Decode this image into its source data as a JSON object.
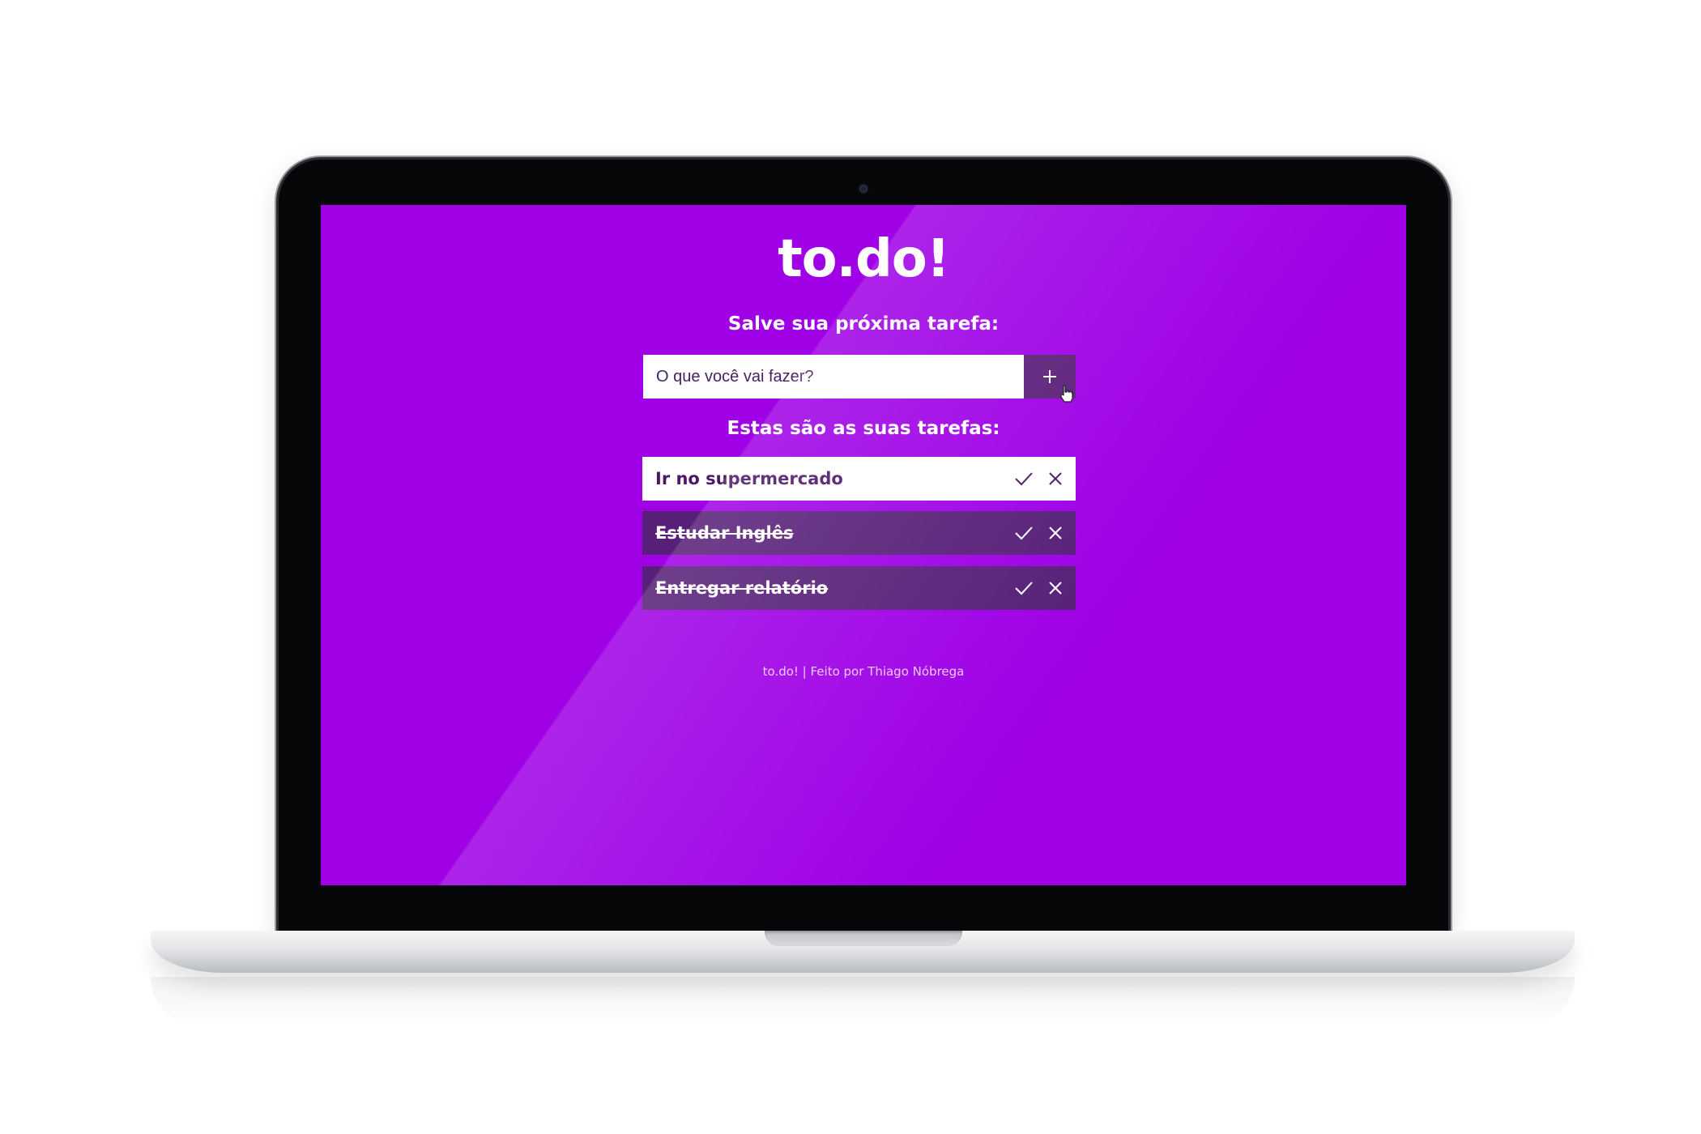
{
  "app": {
    "logo": "to.do!",
    "form_title": "Salve sua próxima tarefa:",
    "input_placeholder": "O que você vai fazer?",
    "add_button_icon": "plus-icon",
    "list_title": "Estas são as suas tarefas:",
    "tasks": [
      {
        "label": "Ir no supermercado",
        "completed": false
      },
      {
        "label": "Estudar Inglês",
        "completed": true
      },
      {
        "label": "Entregar relatório",
        "completed": true
      }
    ],
    "footer": "to.do! | Feito por Thiago Nóbrega"
  },
  "colors": {
    "background": "#9f00e6",
    "accent": "#5b1e7a",
    "completed_task": "#571f78",
    "pending_task": "#ffffff"
  },
  "icons": {
    "complete": "check-icon",
    "delete": "close-icon",
    "add": "plus-icon"
  }
}
